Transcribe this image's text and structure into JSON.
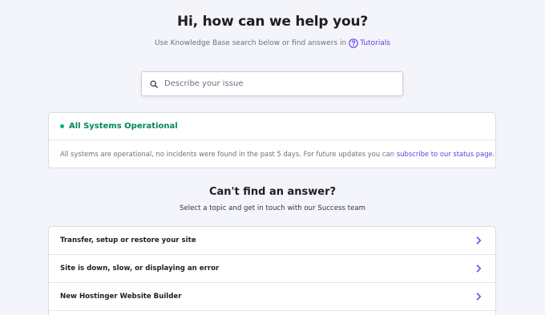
{
  "hero": {
    "title": "Hi, how can we help you?",
    "subtitle": "Use Knowledge Base search below or find answers in",
    "tutorials_link": "Tutorials"
  },
  "search": {
    "placeholder": "Describe your issue",
    "value": "",
    "icon": "search-icon"
  },
  "status": {
    "title": "All Systems Operational",
    "message": "All systems are operational, no incidents were found in the past 5 days. For future updates you can",
    "link": "subscribe to our status page.",
    "color": "#00865a"
  },
  "help": {
    "title": "Can't find an answer?",
    "subtitle": "Select a topic and get in touch with our Success team"
  },
  "topics": [
    {
      "label": "Transfer, setup or restore your site"
    },
    {
      "label": "Site is down, slow, or displaying an error"
    },
    {
      "label": "New Hostinger Website Builder"
    }
  ],
  "colors": {
    "accent": "#673de6",
    "background": "#f4f4fb",
    "success": "#00b090"
  }
}
